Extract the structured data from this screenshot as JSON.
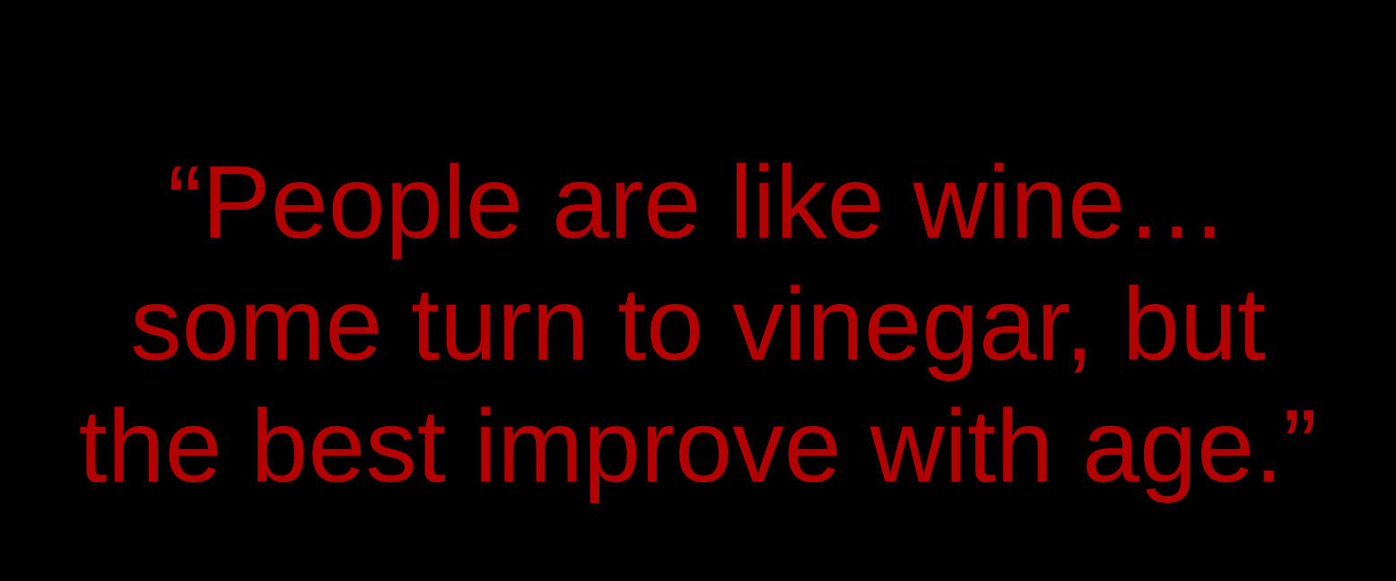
{
  "quote": {
    "lines": [
      "“People are like wine…",
      "some turn to vinegar, but",
      "the best improve with age.”"
    ]
  },
  "colors": {
    "background": "#000000",
    "text": "#b30000"
  }
}
